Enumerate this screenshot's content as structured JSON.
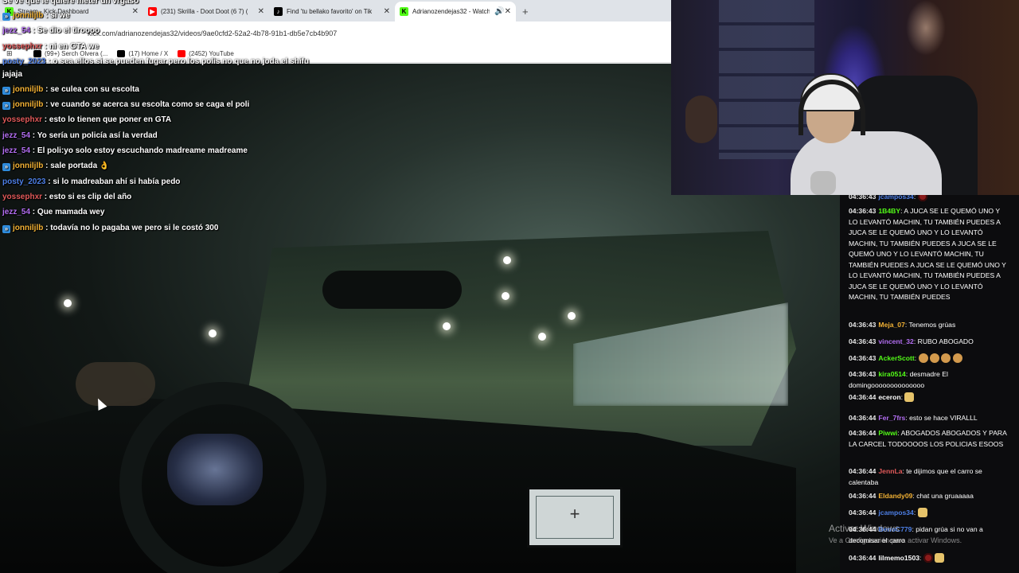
{
  "browser": {
    "tabs": [
      {
        "title": "Stream - Kick Dashboard",
        "favicon_color": "#53fc18",
        "favicon_text": "K",
        "active": false
      },
      {
        "title": "(231) Skrilla - Doot Doot (6 7) (",
        "favicon_color": "#ff0000",
        "favicon_text": "▶",
        "active": false
      },
      {
        "title": "Find 'tu bellako favorito' on Tik",
        "favicon_color": "#000000",
        "favicon_text": "♪",
        "active": false
      },
      {
        "title": "Adrianozendejas32 - Watch",
        "favicon_color": "#53fc18",
        "favicon_text": "K",
        "active": true
      }
    ],
    "new_tab": "+",
    "url": "kick.com/adrianozendejas32/videos/9ae0cfd2-52a2-4b78-91b1-db5e7cb4b907",
    "bookmarks": [
      {
        "label": "(99+) Serch Olvera (...",
        "icon_color": "#000000"
      },
      {
        "label": "(17) Home / X",
        "icon_color": "#000000"
      },
      {
        "label": "(2452) YouTube",
        "icon_color": "#ff0000"
      }
    ]
  },
  "overlay_chat": [
    {
      "user": "",
      "text": "Se ve que le quiere meter un vrgaso",
      "color": "#ffffff",
      "badge": false
    },
    {
      "user": "jonniljlb",
      "text": "si we",
      "color": "#f2b134",
      "badge": true
    },
    {
      "user": "jezz_54",
      "text": "Se dio el tiroooo",
      "color": "#b36ef2",
      "badge": false
    },
    {
      "user": "yossephxr",
      "text": "ni en GTA we",
      "color": "#e25a5a",
      "badge": false
    },
    {
      "user": "posty_2023",
      "text": "o sea ellos si se pueden fugar pero los polis no que no joda el shifu",
      "color": "#4d7fe6",
      "badge": false
    },
    {
      "user": "",
      "text": "jajaja",
      "color": "#ffffff",
      "badge": false
    },
    {
      "user": "jonniljlb",
      "text": "se culea con su escolta",
      "color": "#f2b134",
      "badge": true
    },
    {
      "user": "jonniljlb",
      "text": "ve cuando se acerca su escolta como se caga el poli",
      "color": "#f2b134",
      "badge": true
    },
    {
      "user": "yossephxr",
      "text": "esto lo tienen que poner en GTA",
      "color": "#e25a5a",
      "badge": false
    },
    {
      "user": "jezz_54",
      "text": "Yo sería un policía así la verdad",
      "color": "#b36ef2",
      "badge": false
    },
    {
      "user": "jezz_54",
      "text": "El poli:yo solo estoy escuchando madreame madreame",
      "color": "#b36ef2",
      "badge": false
    },
    {
      "user": "jonniljlb",
      "text": "sale portada 👌",
      "color": "#f2b134",
      "badge": true
    },
    {
      "user": "posty_2023",
      "text": "si lo madreaban ahí si había pedo",
      "color": "#4d7fe6",
      "badge": false
    },
    {
      "user": "yossephxr",
      "text": "esto si es clip del año",
      "color": "#e25a5a",
      "badge": false
    },
    {
      "user": "jezz_54",
      "text": "Que mamada wey",
      "color": "#b36ef2",
      "badge": false
    },
    {
      "user": "jonniljlb",
      "text": "todavía no lo pagaba we pero si le costó 300",
      "color": "#f2b134",
      "badge": true
    }
  ],
  "right_chat": [
    {
      "time": "04:36:43",
      "user": "jcampos34",
      "text": "",
      "color": "#4d7fe6"
    },
    {
      "time": "04:36:43",
      "user": "1B4BY",
      "text": "A JUCA SE LE QUEMÓ UNO Y LO LEVANTÓ MACHIN, TU TAMBIÉN PUEDES A JUCA SE LE QUEMÓ UNO Y LO LEVANTÓ MACHIN, TU TAMBIÉN PUEDES A JUCA SE LE QUEMÓ UNO Y LO LEVANTÓ MACHIN, TU TAMBIÉN PUEDES A JUCA SE LE QUEMÓ UNO Y LO LEVANTÓ MACHIN, TU TAMBIÉN PUEDES A JUCA SE LE QUEMÓ UNO Y LO LEVANTÓ MACHIN, TU TAMBIÉN PUEDES",
      "color": "#53fc18"
    },
    {
      "time": "04:36:43",
      "user": "Meja_07",
      "text": "Tenemos grúas",
      "color": "#f2b134"
    },
    {
      "time": "04:36:43",
      "user": "vincent_32",
      "text": "RUBO ABOGADO",
      "color": "#b36ef2"
    },
    {
      "time": "04:36:43",
      "user": "AckerScott",
      "text": "",
      "color": "#53fc18"
    },
    {
      "time": "04:36:43",
      "user": "kira0514",
      "text": "desmadre El domingoooooooooooooo",
      "color": "#53fc18"
    },
    {
      "time": "04:36:44",
      "user": "eceron",
      "text": "",
      "color": "#ffffff"
    },
    {
      "time": "04:36:44",
      "user": "Fer_7frs",
      "text": "esto se hace VIRALLL",
      "color": "#b36ef2"
    },
    {
      "time": "04:36:44",
      "user": "Piwwi",
      "text": "ABOGADOS ABOGADOS Y PARA LA CARCEL TODOOOOS LOS POLICIAS ESOOS",
      "color": "#53fc18"
    },
    {
      "time": "04:36:44",
      "user": "JennLa",
      "text": "te dijimos que el carro se calentaba",
      "color": "#e25a5a"
    },
    {
      "time": "04:36:44",
      "user": "Eldandy09",
      "text": "chat una gruaaaaa",
      "color": "#f2b134"
    },
    {
      "time": "04:36:44",
      "user": "jcampos34",
      "text": "",
      "color": "#4d7fe6"
    },
    {
      "time": "04:36:44",
      "user": "BenoC779",
      "text": "pidan grúa si no van a decomisar el carro",
      "color": "#4d7fe6"
    },
    {
      "time": "04:36:44",
      "user": "lilmemo1503",
      "text": "",
      "color": "#ffffff"
    }
  ],
  "windows_watermark": {
    "title": "Activar Windows",
    "subtitle": "Ve a Configuración para activar Windows."
  }
}
